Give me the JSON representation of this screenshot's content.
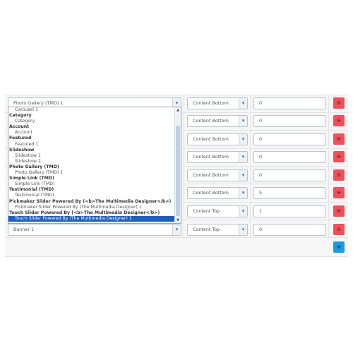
{
  "module_select": {
    "value": "Photo Gallery (TMD) 1"
  },
  "dropdown": {
    "options": [
      {
        "label": "Carousel 1",
        "type": "item"
      },
      {
        "label": "Category",
        "type": "group"
      },
      {
        "label": "Category",
        "type": "item"
      },
      {
        "label": "Account",
        "type": "group"
      },
      {
        "label": "Account",
        "type": "item"
      },
      {
        "label": "Featured",
        "type": "group"
      },
      {
        "label": "Featured 1",
        "type": "item"
      },
      {
        "label": "Slideshow",
        "type": "group"
      },
      {
        "label": "Slideshow 1",
        "type": "item"
      },
      {
        "label": "Slideshow 2",
        "type": "item"
      },
      {
        "label": "Photo Gallery (TMD)",
        "type": "group"
      },
      {
        "label": "Photo Gallery (TMD) 1",
        "type": "item"
      },
      {
        "label": "Simple Link (TMD)",
        "type": "group"
      },
      {
        "label": "Simple Link (TMD)",
        "type": "item"
      },
      {
        "label": "Testimonial (TMD)",
        "type": "group"
      },
      {
        "label": "Testimonial (TMD)",
        "type": "item"
      },
      {
        "label": "Pickmaker Slider Powered By (<b>The Multimedia Designer</b>)",
        "type": "group"
      },
      {
        "label": "Pickmaker Slider Powered By (The Multimedia Designer) 1",
        "type": "item"
      },
      {
        "label": "Touch Slider Powered By (<b>The Multimedia Designer</b>)",
        "type": "group"
      },
      {
        "label": "Touch Slider Powered By (The Multimedia Designer) 1",
        "type": "item",
        "selected": true
      }
    ]
  },
  "last_module": {
    "value": "Banner 1"
  },
  "rows": [
    {
      "position": "Content Bottom",
      "sort": "0"
    },
    {
      "position": "Content Bottom",
      "sort": "0"
    },
    {
      "position": "Content Bottom",
      "sort": "0"
    },
    {
      "position": "Content Bottom",
      "sort": "0"
    },
    {
      "position": "Content Bottom",
      "sort": "0"
    },
    {
      "position": "Content Bottom",
      "sort": "5"
    },
    {
      "position": "Content Top",
      "sort": "1"
    },
    {
      "position": "Content Top",
      "sort": "0"
    }
  ],
  "icons": {
    "remove": "minus-circle-icon",
    "add": "plus-circle-icon",
    "dropdown": "chevron-down-icon"
  },
  "colors": {
    "remove": "#f0505a",
    "add": "#1f9be0",
    "highlight": "#1f5fbf"
  }
}
